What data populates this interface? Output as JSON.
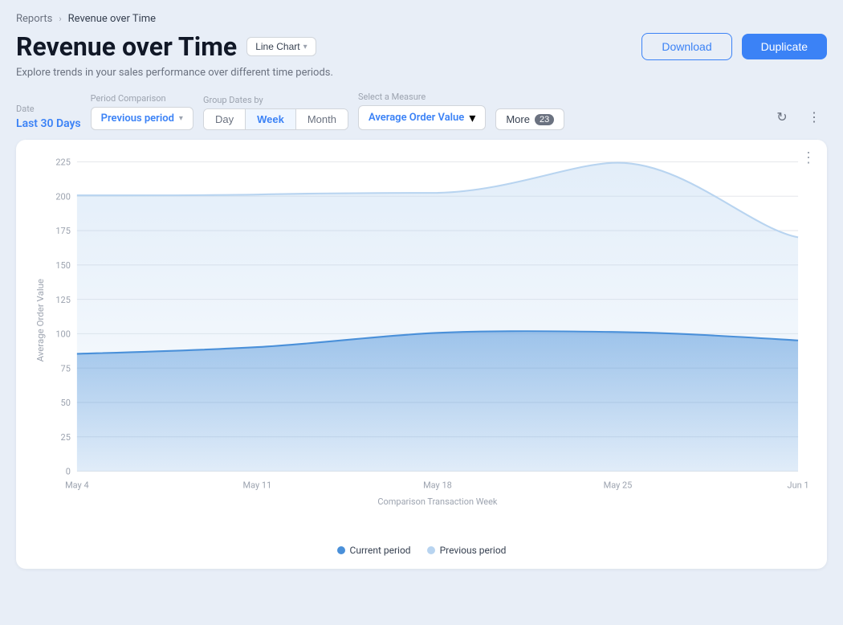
{
  "breadcrumb": {
    "parent": "Reports",
    "current": "Revenue over Time"
  },
  "header": {
    "title": "Revenue over Time",
    "chart_type_label": "Line Chart",
    "subtitle": "Explore trends in your sales performance over different time periods.",
    "download_label": "Download",
    "duplicate_label": "Duplicate"
  },
  "filters": {
    "date_label": "Date",
    "date_value": "Last 30 Days",
    "period_comparison_label": "Period Comparison",
    "period_comparison_value": "Previous period",
    "group_dates_label": "Group Dates by",
    "group_day": "Day",
    "group_week": "Week",
    "group_month": "Month",
    "group_active": "Week",
    "measure_label": "Select a Measure",
    "measure_value": "Average Order Value",
    "more_label": "More",
    "more_count": "23"
  },
  "chart": {
    "y_label": "Average Order Value",
    "x_label": "Comparison Transaction Week",
    "x_ticks": [
      "May 4",
      "May 11",
      "May 18",
      "May 25",
      "Jun 1"
    ],
    "y_ticks": [
      "0",
      "25",
      "50",
      "75",
      "100",
      "125",
      "150",
      "175",
      "200",
      "225"
    ],
    "legend_current": "Current period",
    "legend_previous": "Previous period",
    "three_dots_label": "⋮"
  }
}
